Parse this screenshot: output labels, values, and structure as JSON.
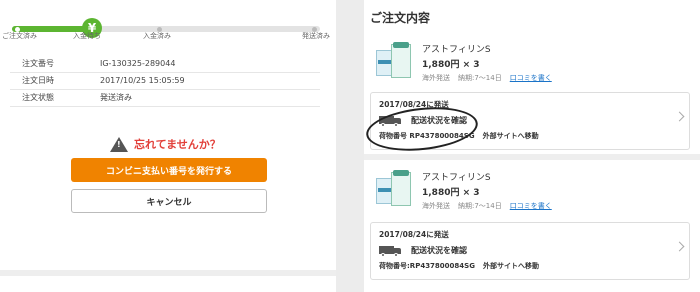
{
  "progress": {
    "steps": [
      "ご注文済み",
      "入金待ち",
      "入金済み",
      "発送済み"
    ],
    "current_step_icon": "¥",
    "accent_color": "#5cb531"
  },
  "order_info": {
    "rows": [
      {
        "label": "注文番号",
        "value": "IG-130325-289044"
      },
      {
        "label": "注文日時",
        "value": "2017/10/25 15:05:59"
      },
      {
        "label": "注文状態",
        "value": "発送済み"
      }
    ]
  },
  "warning": {
    "text": "忘れてませんか？",
    "icon": "warning-icon",
    "color": "#e2403a"
  },
  "buttons": {
    "issue_label": "コンビニ支払い番号を発行する",
    "cancel_label": "キャンセル"
  },
  "order_details": {
    "title": "ご注文内容",
    "items": [
      {
        "name": "アストフィリンS",
        "price": "1,880円 × 3",
        "origin": "海外発送",
        "delivery": "納期:7～14日",
        "review_label": "口コミを書く",
        "shipment": {
          "date": "2017/08/24に発送",
          "status": "配送状況を確認",
          "tracking": "荷物番号 RP437800084SG",
          "external": "外部サイトへ移動"
        }
      },
      {
        "name": "アストフィリンS",
        "price": "1,880円 × 3",
        "origin": "海外発送",
        "delivery": "納期:7～14日",
        "review_label": "口コミを書く",
        "shipment": {
          "date": "2017/08/24に発送",
          "status": "配送状況を確認",
          "tracking": "荷物番号:RP437800084SG",
          "external": "外部サイトへ移動"
        }
      }
    ]
  }
}
